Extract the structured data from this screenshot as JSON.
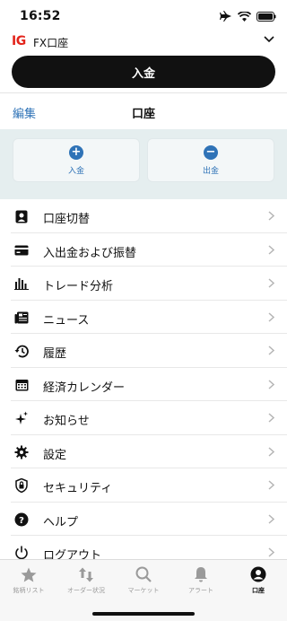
{
  "status_bar": {
    "time": "16:52"
  },
  "account": {
    "brand": "IG",
    "title": "FX口座"
  },
  "primary_action": {
    "label": "入金"
  },
  "header": {
    "edit": "編集",
    "title": "口座"
  },
  "actions": {
    "deposit": "入金",
    "withdraw": "出金"
  },
  "menu": [
    {
      "label": "口座切替",
      "icon": "account-switch-icon"
    },
    {
      "label": "入出金および振替",
      "icon": "card-icon"
    },
    {
      "label": "トレード分析",
      "icon": "bar-chart-icon"
    },
    {
      "label": "ニュース",
      "icon": "news-icon"
    },
    {
      "label": "履歴",
      "icon": "history-icon"
    },
    {
      "label": "経済カレンダー",
      "icon": "calendar-icon"
    },
    {
      "label": "お知らせ",
      "icon": "sparkle-icon"
    },
    {
      "label": "設定",
      "icon": "gear-icon"
    },
    {
      "label": "セキュリティ",
      "icon": "shield-icon"
    },
    {
      "label": "ヘルプ",
      "icon": "help-icon"
    },
    {
      "label": "ログアウト",
      "icon": "power-icon"
    }
  ],
  "tabs": [
    {
      "label": "銘柄リスト",
      "icon": "star-icon",
      "active": false
    },
    {
      "label": "オーダー状況",
      "icon": "arrows-icon",
      "active": false
    },
    {
      "label": "マーケット",
      "icon": "search-icon",
      "active": false
    },
    {
      "label": "アラート",
      "icon": "bell-icon",
      "active": false
    },
    {
      "label": "口座",
      "icon": "user-icon",
      "active": true
    }
  ],
  "colors": {
    "brand": "#e3241b",
    "accent": "#2f73b7",
    "primary_button": "#111111",
    "action_area": "#e5eeef"
  }
}
